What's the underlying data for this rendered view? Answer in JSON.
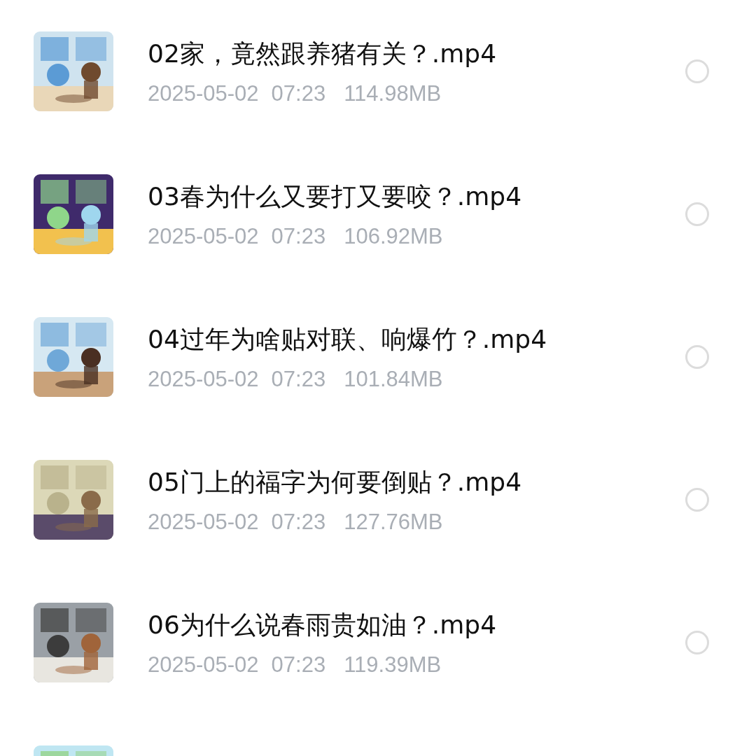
{
  "files": [
    {
      "title": "02家，竟然跟养猪有关？.mp4",
      "date": "2025-05-02",
      "time": "07:23",
      "size": "114.98MB",
      "selected": false,
      "thumbnail": {
        "kind": "picture"
      }
    },
    {
      "title": "03春为什么又要打又要咬？.mp4",
      "date": "2025-05-02",
      "time": "07:23",
      "size": "106.92MB",
      "selected": false,
      "thumbnail": {
        "kind": "picture"
      }
    },
    {
      "title": "04过年为啥贴对联、响爆竹？.mp4",
      "date": "2025-05-02",
      "time": "07:23",
      "size": "101.84MB",
      "selected": false,
      "thumbnail": {
        "kind": "picture"
      }
    },
    {
      "title": "05门上的福字为何要倒贴？.mp4",
      "date": "2025-05-02",
      "time": "07:23",
      "size": "127.76MB",
      "selected": false,
      "thumbnail": {
        "kind": "picture"
      }
    },
    {
      "title": "06为什么说春雨贵如油？.mp4",
      "date": "2025-05-02",
      "time": "07:23",
      "size": "119.39MB",
      "selected": false,
      "thumbnail": {
        "kind": "picture"
      }
    },
    {
      "thumbnail": {
        "kind": "picture"
      }
    }
  ]
}
